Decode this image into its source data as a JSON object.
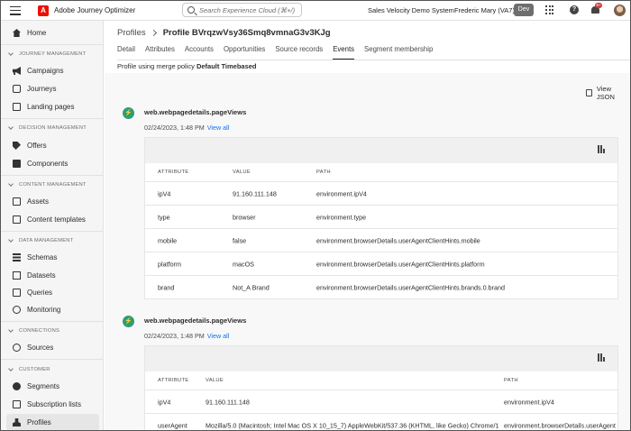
{
  "topbar": {
    "app_name": "Adobe Journey Optimizer",
    "logo_letter": "A",
    "search_placeholder": "Search Experience Cloud (⌘+/)",
    "org_name": "Sales Velocity Demo System",
    "user_name": "Frederic Mary (VA7)",
    "env_badge": "Dev",
    "help_glyph": "?",
    "notification_count": "9+"
  },
  "sidebar": {
    "home": "Home",
    "sections": {
      "journey_management": "JOURNEY MANAGEMENT",
      "decision_management": "DECISION MANAGEMENT",
      "content_management": "CONTENT MANAGEMENT",
      "data_management": "DATA MANAGEMENT",
      "connections": "CONNECTIONS",
      "customer": "CUSTOMER"
    },
    "items": {
      "campaigns": "Campaigns",
      "journeys": "Journeys",
      "landing_pages": "Landing pages",
      "offers": "Offers",
      "components": "Components",
      "assets": "Assets",
      "content_templates": "Content templates",
      "schemas": "Schemas",
      "datasets": "Datasets",
      "queries": "Queries",
      "monitoring": "Monitoring",
      "sources": "Sources",
      "segments": "Segments",
      "subscription_lists": "Subscription lists",
      "profiles": "Profiles"
    }
  },
  "breadcrumb": {
    "parent": "Profiles",
    "current": "Profile BVrqzwVsy36Smq8vmnaG3v3KJg"
  },
  "tabs": [
    "Detail",
    "Attributes",
    "Accounts",
    "Opportunities",
    "Source records",
    "Events",
    "Segment membership"
  ],
  "active_tab": "Events",
  "merge_policy": {
    "prefix": "Profile using merge policy",
    "name": "Default Timebased"
  },
  "view_json": "View JSON",
  "events": [
    {
      "icon_glyph": "⚡",
      "title": "web.webpagedetails.pageViews",
      "date": "02/24/2023, 1:48 PM",
      "view_all": "View all",
      "headers": [
        "ATTRIBUTE",
        "VALUE",
        "PATH"
      ],
      "rows": [
        [
          "ipV4",
          "91.160.111.148",
          "environment.ipV4"
        ],
        [
          "type",
          "browser",
          "environment.type"
        ],
        [
          "mobile",
          "false",
          "environment.browserDetails.userAgentClientHints.mobile"
        ],
        [
          "platform",
          "macOS",
          "environment.browserDetails.userAgentClientHints.platform"
        ],
        [
          "brand",
          "Not_A Brand",
          "environment.browserDetails.userAgentClientHints.brands.0.brand"
        ]
      ]
    },
    {
      "icon_glyph": "⚡",
      "title": "web.webpagedetails.pageViews",
      "date": "02/24/2023, 1:48 PM",
      "view_all": "View all",
      "headers": [
        "ATTRIBUTE",
        "VALUE",
        "PATH"
      ],
      "rows": [
        [
          "ipV4",
          "91.160.111.148",
          "environment.ipV4"
        ],
        [
          "userAgent",
          "Mozilla/5.0 (Macintosh; Intel Mac OS X 10_15_7) AppleWebKit/537.36 (KHTML, like Gecko) Chrome/1...",
          "environment.browserDetails.userAgent"
        ]
      ]
    }
  ]
}
